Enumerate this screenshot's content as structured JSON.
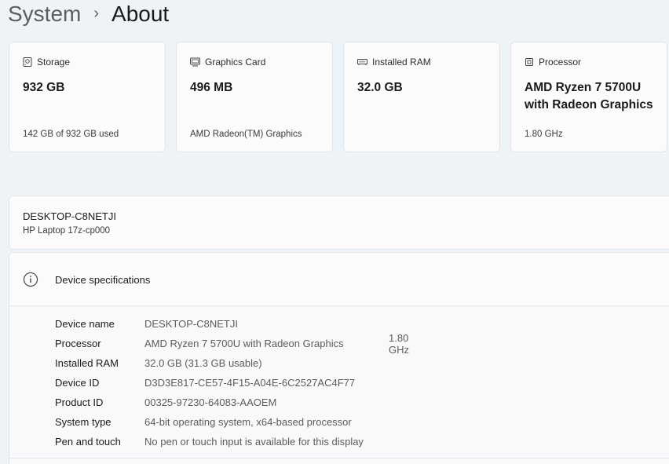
{
  "breadcrumb": {
    "parent": "System",
    "separator": "›",
    "current": "About"
  },
  "cards": [
    {
      "icon": "storage-icon",
      "label": "Storage",
      "value": "932 GB",
      "sub": "142 GB of 932 GB used"
    },
    {
      "icon": "graphics-card-icon",
      "label": "Graphics Card",
      "value": "496 MB",
      "sub": "AMD Radeon(TM) Graphics"
    },
    {
      "icon": "ram-icon",
      "label": "Installed RAM",
      "value": "32.0 GB",
      "sub": ""
    },
    {
      "icon": "processor-icon",
      "label": "Processor",
      "value": "AMD Ryzen 7 5700U with Radeon Graphics",
      "sub": "1.80 GHz"
    }
  ],
  "device": {
    "name": "DESKTOP-C8NETJI",
    "model": "HP Laptop 17z-cp000"
  },
  "specs": {
    "title": "Device specifications",
    "rows": [
      {
        "label": "Device name",
        "value": "DESKTOP-C8NETJI"
      },
      {
        "label": "Processor",
        "value": "AMD Ryzen 7 5700U with Radeon Graphics",
        "extra": "1.80 GHz"
      },
      {
        "label": "Installed RAM",
        "value": "32.0 GB (31.3 GB usable)"
      },
      {
        "label": "Device ID",
        "value": "D3D3E817-CE57-4F15-A04E-6C2527AC4F77"
      },
      {
        "label": "Product ID",
        "value": "00325-97230-64083-AAOEM"
      },
      {
        "label": "System type",
        "value": "64-bit operating system, x64-based processor"
      },
      {
        "label": "Pen and touch",
        "value": "No pen or touch input is available for this display"
      }
    ]
  }
}
